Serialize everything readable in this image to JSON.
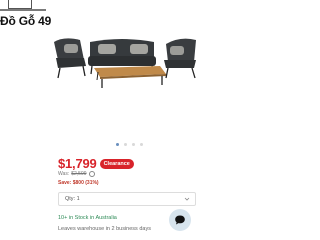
{
  "watermark": {
    "text": "Đồ Gỗ 49"
  },
  "product": {
    "image_alt": "outdoor-lounge-set",
    "carousel": {
      "count": 4,
      "active_index": 0
    }
  },
  "pricing": {
    "price": "$1,799",
    "badge": "Clearance",
    "was_label": "Was:",
    "was_value": "$2,599",
    "save_text": "Save: $800 (31%)"
  },
  "quantity": {
    "label": "Qty: 1"
  },
  "stock": {
    "text": "10+ in Stock in Australia"
  },
  "delivery": {
    "text": "Leaves warehouse in 2 business days"
  },
  "colors": {
    "accent": "#d8232a",
    "stock": "#2e8b57",
    "chat_bg": "#d7e4ed"
  },
  "icons": {
    "info": "info-icon",
    "chevron": "chevron-down-icon",
    "chat": "chat-icon"
  }
}
